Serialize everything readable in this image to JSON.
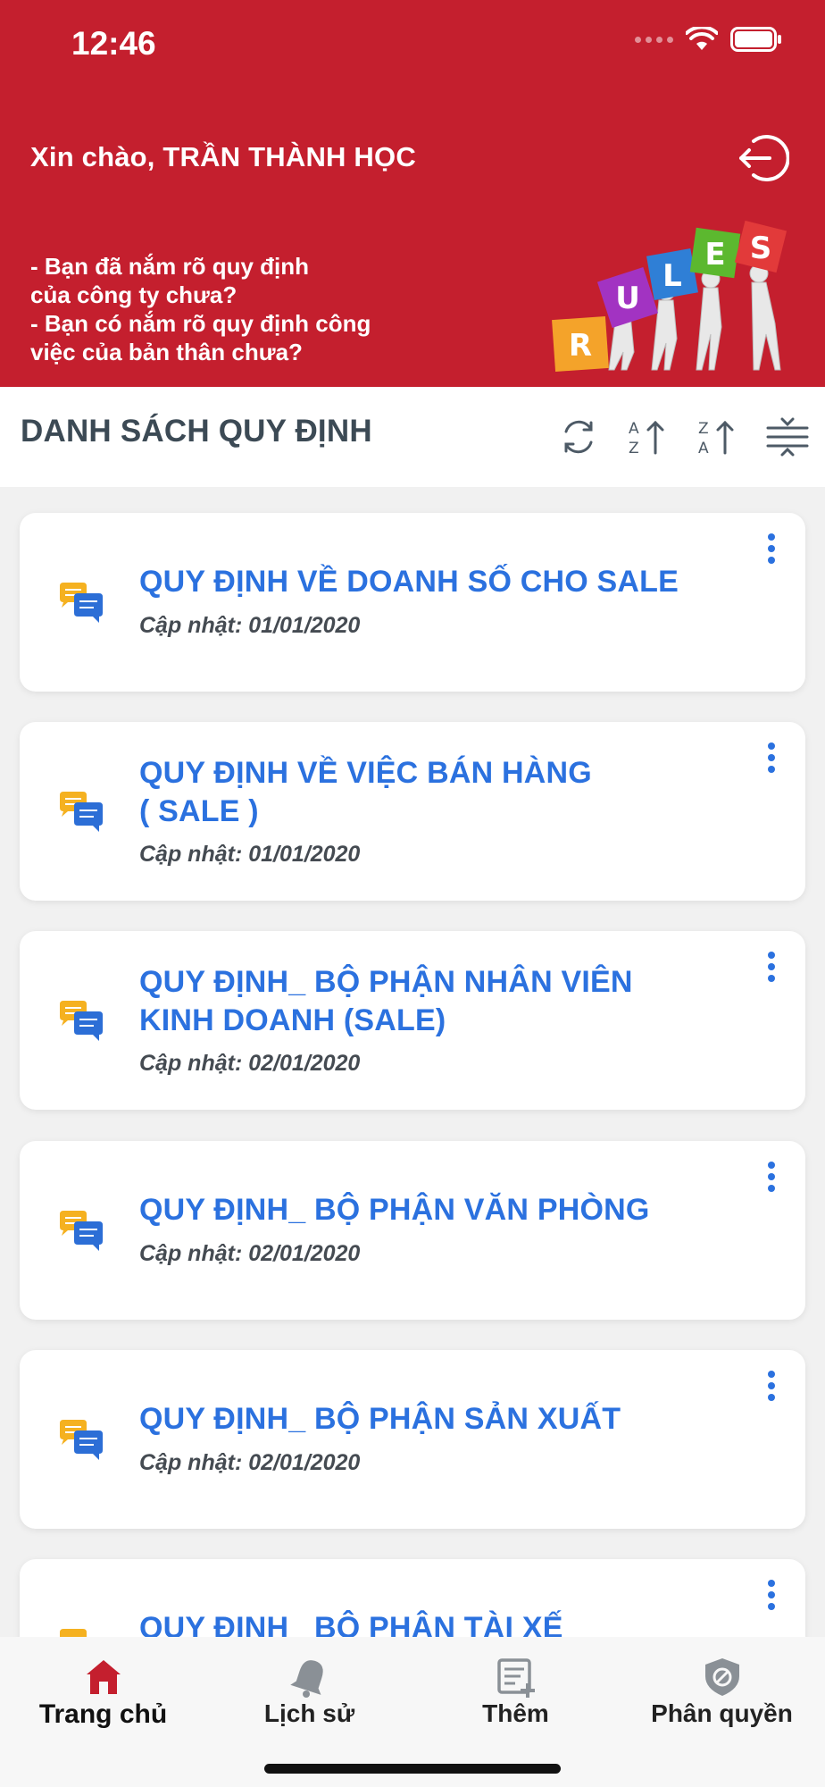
{
  "status_bar": {
    "time": "12:46"
  },
  "header": {
    "greeting": "Xin chào, TRẦN THÀNH HỌC",
    "reminder_lines": [
      "- Bạn đã nắm rõ quy định",
      "của công ty chưa?",
      "- Bạn có nắm rõ quy định công",
      "việc của bản thân chưa?"
    ],
    "illustration_letters": [
      "R",
      "U",
      "L",
      "E",
      "S"
    ]
  },
  "toolbar": {
    "title": "DANH SÁCH QUY ĐỊNH"
  },
  "rules": [
    {
      "title": "QUY ĐỊNH VỀ DOANH SỐ CHO SALE",
      "date": "Cập nhật: 01/01/2020"
    },
    {
      "title_lines": [
        "QUY ĐỊNH VỀ VIỆC BÁN HÀNG",
        "( SALE )"
      ],
      "date": "Cập nhật: 01/01/2020"
    },
    {
      "title_lines": [
        "QUY ĐỊNH_ BỘ PHẬN NHÂN VIÊN",
        "KINH DOANH (SALE)"
      ],
      "date": "Cập nhật: 02/01/2020"
    },
    {
      "title": "QUY ĐỊNH_ BỘ PHẬN VĂN PHÒNG",
      "date": "Cập nhật: 02/01/2020"
    },
    {
      "title": "QUY ĐỊNH_ BỘ PHẬN SẢN XUẤT",
      "date": "Cập nhật: 02/01/2020"
    },
    {
      "title": "QUY ĐỊNH_ BỘ PHẬN TÀI XẾ"
    }
  ],
  "bottom_nav": [
    {
      "label": "Trang chủ",
      "icon": "home-icon",
      "active": true
    },
    {
      "label": "Lịch sử",
      "icon": "bell-icon"
    },
    {
      "label": "Thêm",
      "icon": "add-list-icon"
    },
    {
      "label": "Phân quyền",
      "icon": "shield-icon"
    }
  ],
  "colors": {
    "brand_red": "#c41f2e",
    "title_blue": "#2b71df",
    "active_nav": "#c41f2e",
    "inactive_nav": "#8a9096"
  }
}
